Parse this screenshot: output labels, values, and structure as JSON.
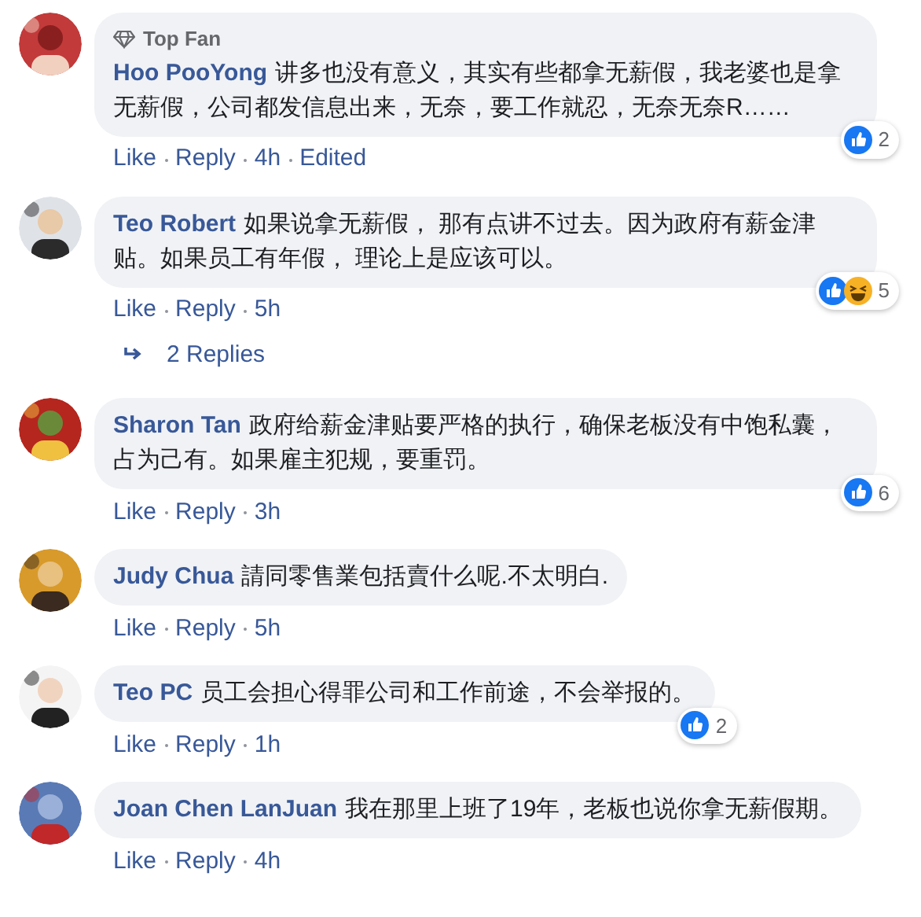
{
  "comments": [
    {
      "avatar": {
        "kind": "picture"
      },
      "badge": "Top Fan",
      "author": "Hoo PooYong",
      "text": "讲多也没有意义，其实有些都拿无薪假，我老婆也是拿无薪假，公司都发信息出来，无奈，要工作就忍，无奈无奈R……",
      "reactions": [
        {
          "kind": "like"
        }
      ],
      "reaction_count": "2",
      "actions": [
        "Like",
        "Reply"
      ],
      "time": "4h",
      "edited": "Edited"
    },
    {
      "avatar": {
        "kind": "picture"
      },
      "author": "Teo Robert",
      "text": "如果说拿无薪假， 那有点讲不过去。因为政府有薪金津贴。如果员工有年假， 理论上是应该可以。",
      "reactions": [
        {
          "kind": "like"
        },
        {
          "kind": "haha"
        }
      ],
      "reaction_count": "5",
      "actions": [
        "Like",
        "Reply"
      ],
      "time": "5h",
      "replies": "2 Replies"
    },
    {
      "avatar": {
        "kind": "picture"
      },
      "author": "Sharon Tan",
      "text": "政府给薪金津贴要严格的执行，确保老板没有中饱私囊，占为己有。如果雇主犯规，要重罚。",
      "reactions": [
        {
          "kind": "like"
        }
      ],
      "reaction_count": "6",
      "actions": [
        "Like",
        "Reply"
      ],
      "time": "3h"
    },
    {
      "avatar": {
        "kind": "picture"
      },
      "author": "Judy Chua",
      "text": "請同零售業包括賣什么呢.不太明白.",
      "actions": [
        "Like",
        "Reply"
      ],
      "time": "5h"
    },
    {
      "avatar": {
        "kind": "picture"
      },
      "author": "Teo PC",
      "text": "员工会担心得罪公司和工作前途，不会举报的。",
      "reactions": [
        {
          "kind": "like"
        }
      ],
      "reaction_count": "2",
      "actions": [
        "Like",
        "Reply"
      ],
      "time": "1h"
    },
    {
      "avatar": {
        "kind": "picture"
      },
      "author": "Joan Chen LanJuan",
      "text": "我在那里上班了19年，老板也说你拿无薪假期。",
      "actions": [
        "Like",
        "Reply"
      ],
      "time": "4h"
    }
  ]
}
